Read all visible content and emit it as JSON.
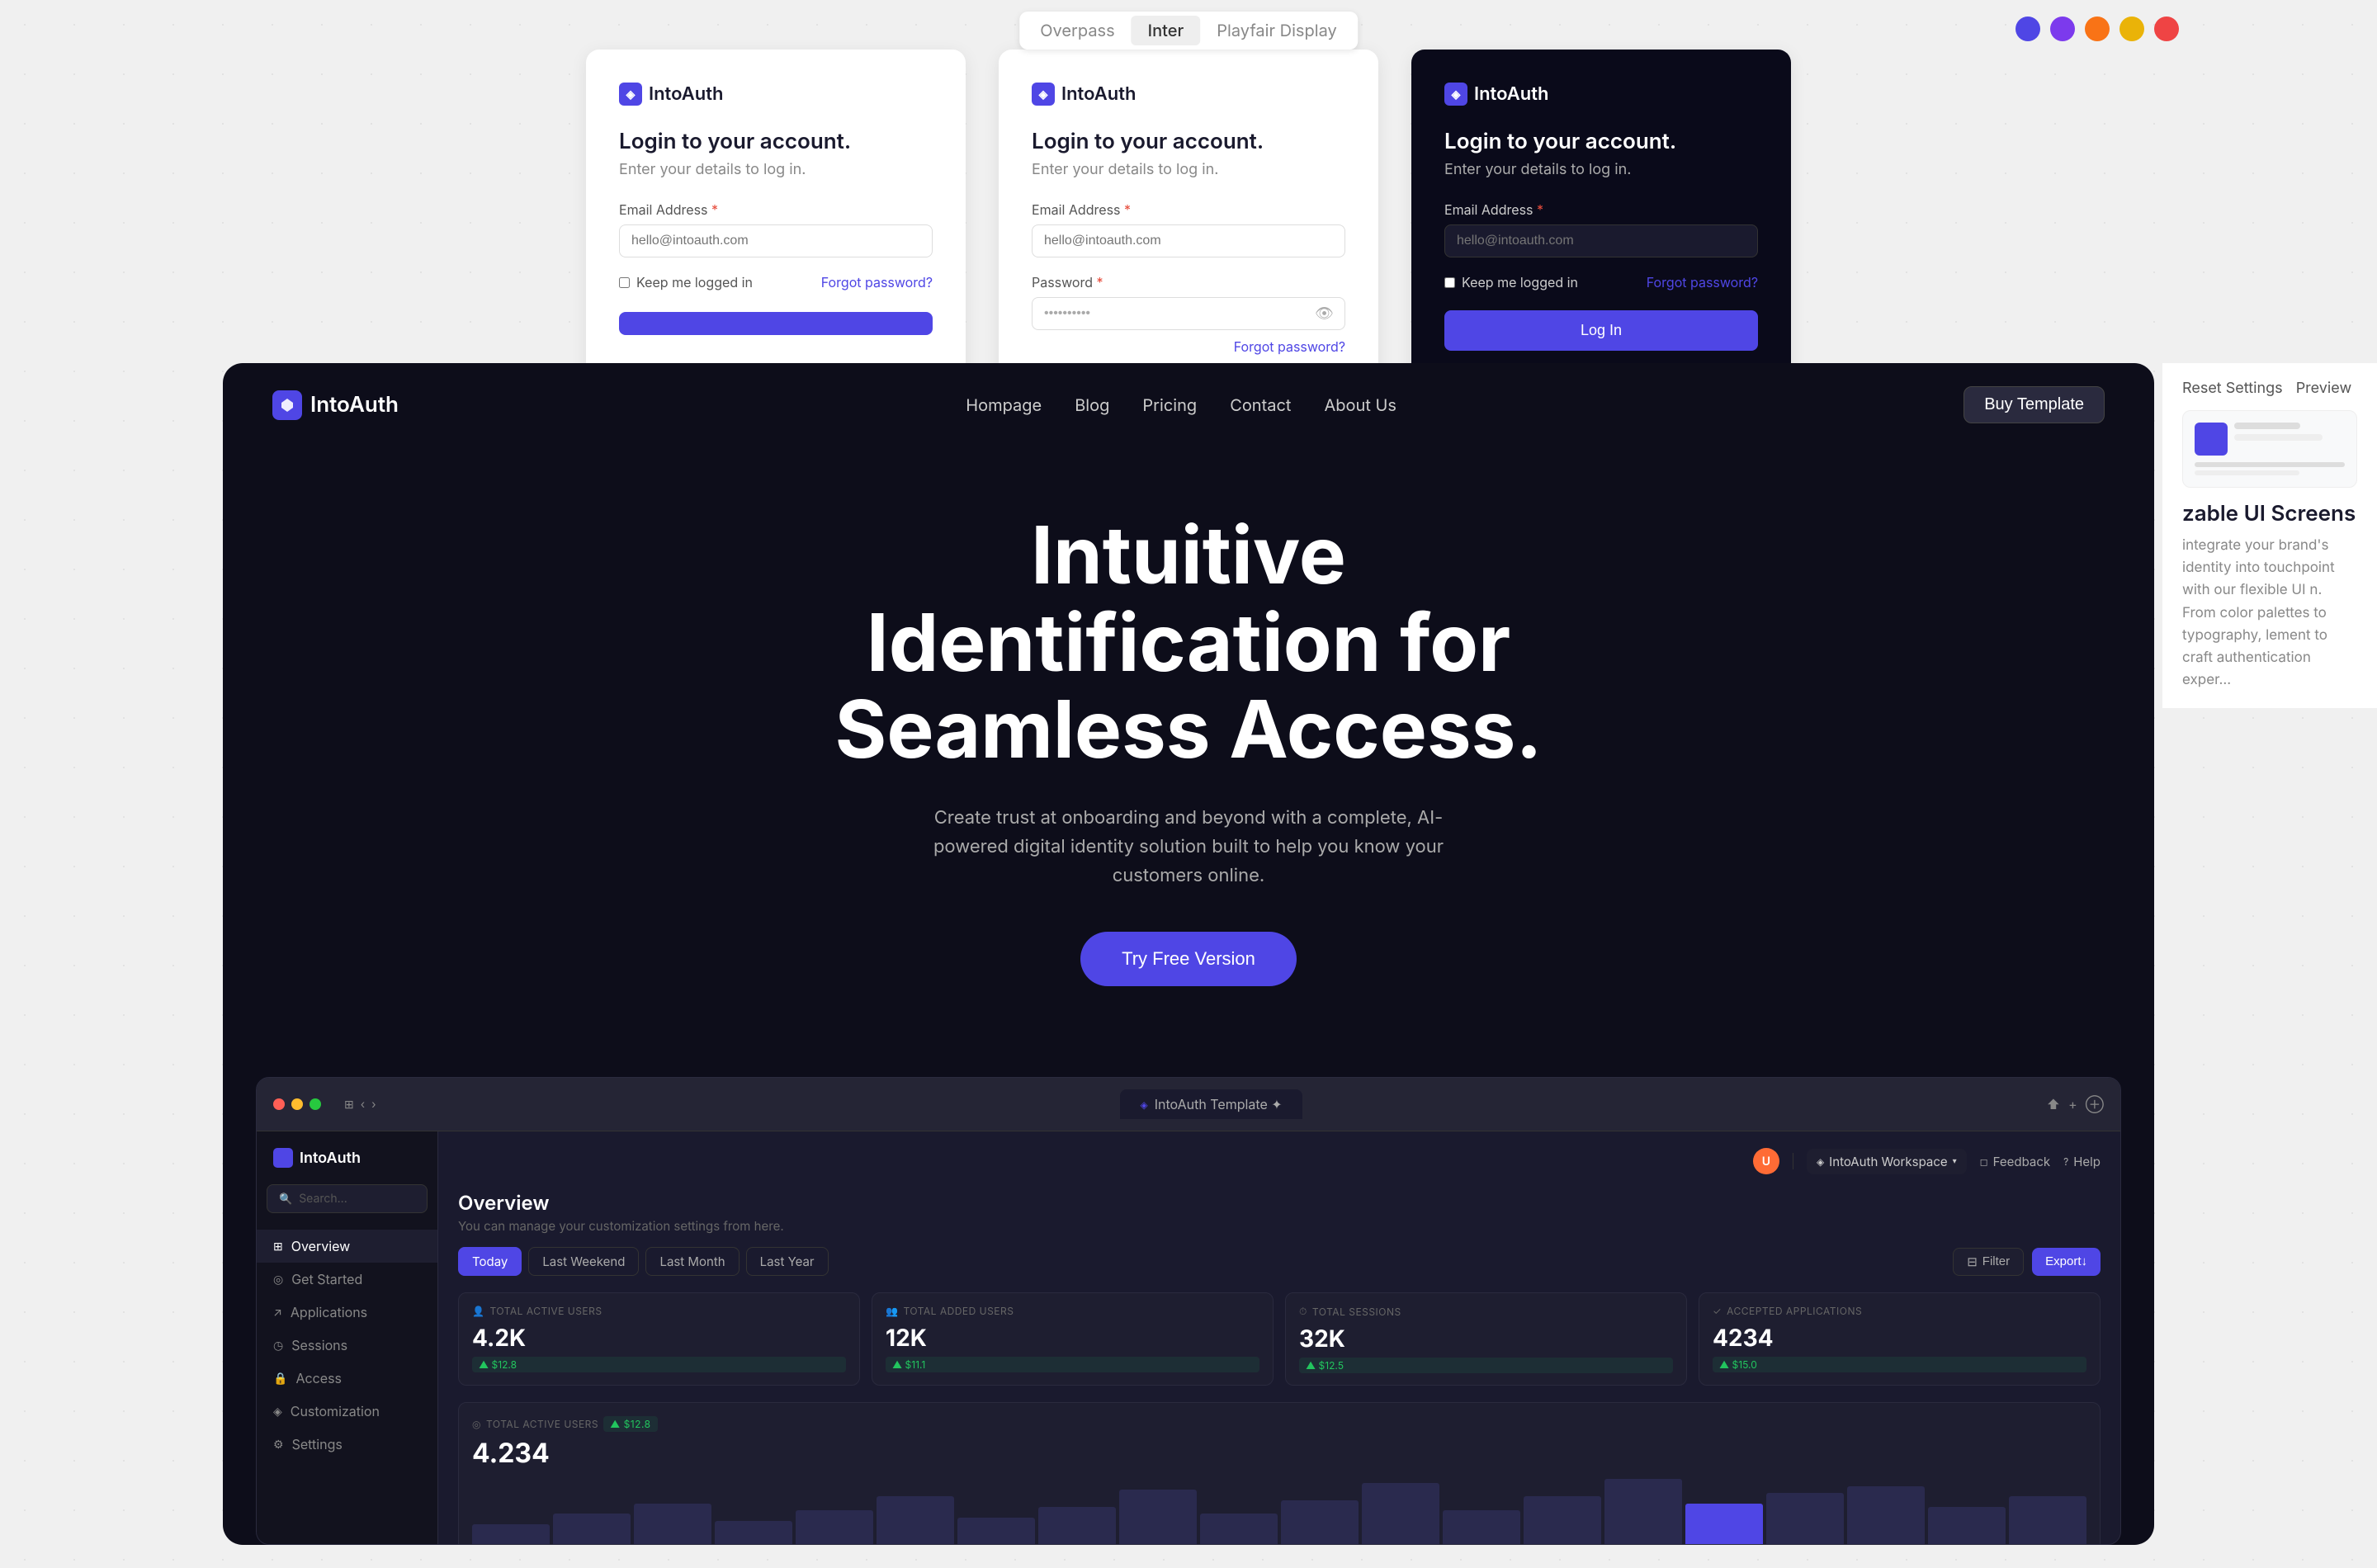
{
  "background": {
    "color": "#f0f0f0"
  },
  "font_tabs": {
    "items": [
      "Overpass",
      "Inter",
      "Playfair Display"
    ]
  },
  "color_dots": [
    "#4f46e5",
    "#7c3aed",
    "#f97316",
    "#eab308",
    "#ef4444"
  ],
  "login_cards": [
    {
      "logo": "IntoAuth",
      "title": "Login to your account.",
      "subtitle": "Enter your details to log in.",
      "email_label": "Email Address",
      "email_placeholder": "hello@intoauth.com",
      "keep_logged": "Keep me logged in",
      "forgot": "Forgot password?",
      "theme": "light"
    },
    {
      "logo": "IntoAuth",
      "title": "Login to your account.",
      "subtitle": "Enter your details to log in.",
      "email_label": "Email Address",
      "email_placeholder": "hello@intoauth.com",
      "password_label": "Password",
      "forgot": "Forgot password?",
      "theme": "light"
    },
    {
      "logo": "IntoAuth",
      "title": "Login to your account.",
      "subtitle": "Enter your details to log in.",
      "email_label": "Email Address",
      "email_placeholder": "hello@intoauth.com",
      "keep_logged": "Keep me logged in",
      "forgot": "Forgot password?",
      "login_button": "Log In",
      "theme": "dark"
    }
  ],
  "nav": {
    "logo": "IntoAuth",
    "links": [
      "Hompage",
      "Blog",
      "Pricing",
      "Contact",
      "About Us"
    ],
    "buy_button": "Buy Template"
  },
  "hero": {
    "title_line1": "Intuitive",
    "title_line2": "Identification for",
    "title_line3": "Seamless Access.",
    "subtitle": "Create trust at onboarding and beyond with a complete, AI-powered digital identity solution built to help you know your customers online.",
    "cta_button": "Try Free Version"
  },
  "dashboard": {
    "browser_tab": "IntoAuth Template ✦",
    "sidebar": {
      "logo": "IntoAuth",
      "search_placeholder": "Search...",
      "items": [
        {
          "label": "Overview",
          "active": true
        },
        {
          "label": "Get Started",
          "active": false
        },
        {
          "label": "Applications",
          "active": false
        },
        {
          "label": "Sessions",
          "active": false
        },
        {
          "label": "Access",
          "active": false
        },
        {
          "label": "Customization",
          "active": false
        },
        {
          "label": "Settings",
          "active": false
        }
      ]
    },
    "header": {
      "workspace": "IntoAuth Workspace",
      "feedback": "Feedback",
      "help": "Help"
    },
    "overview": {
      "title": "Overview",
      "subtitle": "You can manage your customization settings from here.",
      "filter_tabs": [
        "Today",
        "Last Weekend",
        "Last Month",
        "Last Year"
      ],
      "active_tab": "Today",
      "filter_button": "Filter",
      "export_button": "Export↓"
    },
    "stats": [
      {
        "label": "TOTAL ACTIVE USERS",
        "value": "4.2K",
        "change": "▲ $12.8"
      },
      {
        "label": "TOTAL ADDED USERS",
        "value": "12K",
        "change": "▲ $11.1"
      },
      {
        "label": "TOTAL SESSIONS",
        "value": "32K",
        "change": "▲ $12.5"
      },
      {
        "label": "ACCEPTED APPLICATIONS",
        "value": "4234",
        "change": "▲ $15.0"
      }
    ],
    "chart": {
      "label": "TOTAL ACTIVE USERS",
      "change": "▲ $12.8",
      "value": "4.234",
      "bars": [
        30,
        45,
        60,
        35,
        50,
        70,
        40,
        55,
        80,
        45,
        65,
        90,
        50,
        70,
        95,
        60,
        75,
        85,
        55,
        70
      ]
    }
  },
  "right_panel": {
    "reset_label": "Reset Settings",
    "preview_label": "Preview",
    "customizable_title": "zable UI Screens",
    "customizable_text": "integrate your brand's identity into touchpoint with our flexible UI n. From color palettes to typography, lement to craft authentication exper..."
  }
}
